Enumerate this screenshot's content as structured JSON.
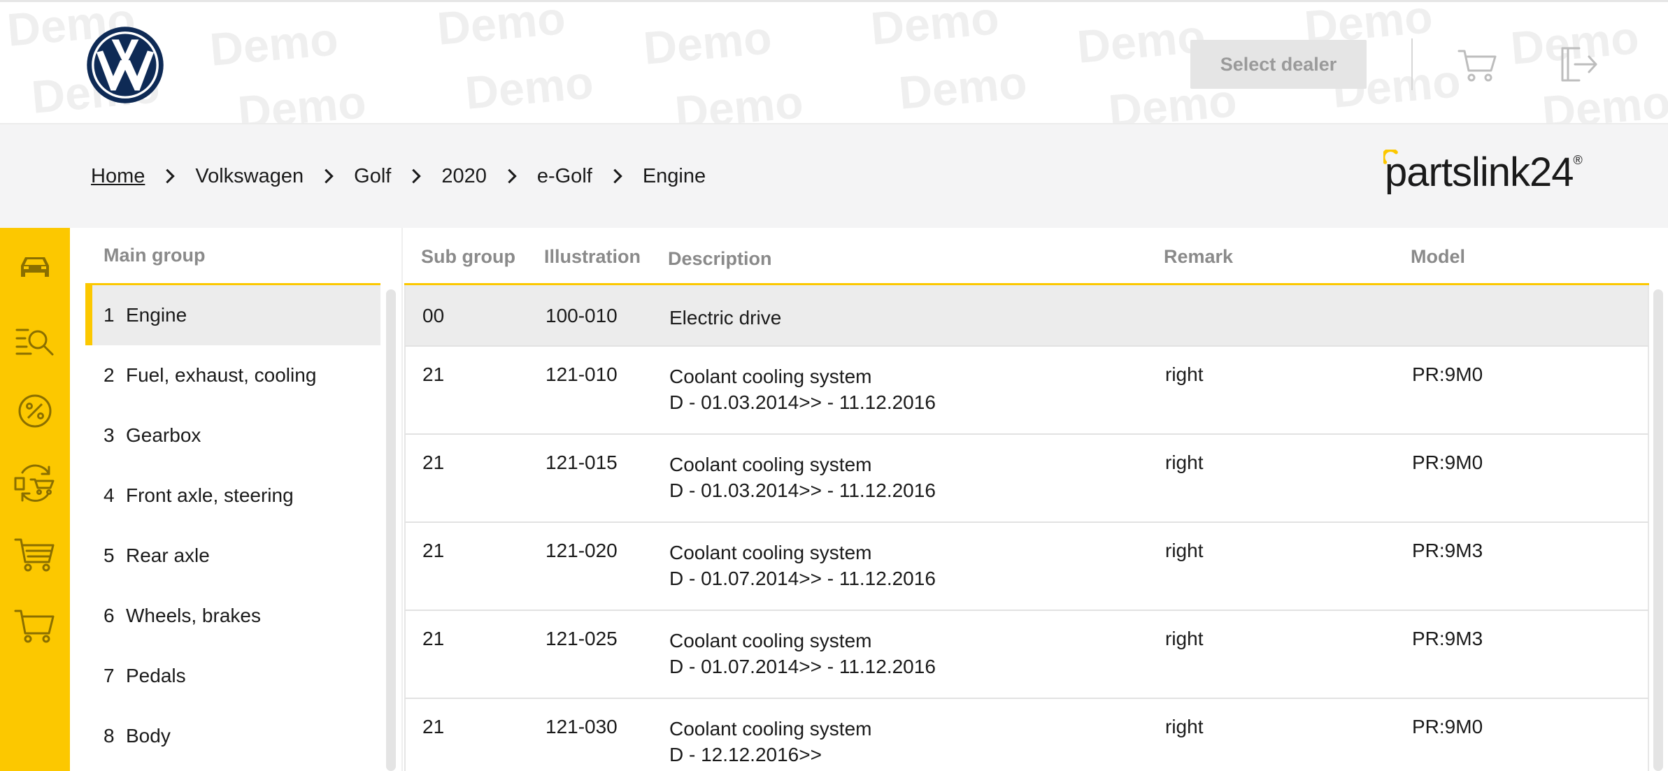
{
  "header": {
    "watermark_text": "Demo",
    "select_dealer_label": "Select dealer",
    "brand_icon": "vw-logo",
    "icons": [
      "cart-icon",
      "logout-icon"
    ]
  },
  "breadcrumb": {
    "items": [
      "Home",
      "Volkswagen",
      "Golf",
      "2020",
      "e-Golf",
      "Engine"
    ]
  },
  "partslink": {
    "text_a": "partslink",
    "text_b": "24",
    "reg": "®"
  },
  "rail": {
    "icons": [
      "car-icon",
      "search-list-icon",
      "percent-icon",
      "cart-exchange-icon",
      "cart-full-icon",
      "cart-icon"
    ]
  },
  "main_group": {
    "header": "Main group",
    "items": [
      {
        "num": "1",
        "label": "Engine"
      },
      {
        "num": "2",
        "label": "Fuel, exhaust, cooling"
      },
      {
        "num": "3",
        "label": "Gearbox"
      },
      {
        "num": "4",
        "label": "Front axle, steering"
      },
      {
        "num": "5",
        "label": "Rear axle"
      },
      {
        "num": "6",
        "label": "Wheels, brakes"
      },
      {
        "num": "7",
        "label": "Pedals"
      },
      {
        "num": "8",
        "label": "Body"
      }
    ]
  },
  "table": {
    "headers": {
      "sub": "Sub group",
      "ill": "Illustration",
      "desc": "Description",
      "rem": "Remark",
      "mod": "Model"
    },
    "rows": [
      {
        "sub": "00",
        "ill": "100-010",
        "desc1": "Electric drive",
        "desc2": "",
        "rem": "",
        "mod": ""
      },
      {
        "sub": "21",
        "ill": "121-010",
        "desc1": "Coolant cooling system",
        "desc2": "D - 01.03.2014>> - 11.12.2016",
        "rem": "right",
        "mod": "PR:9M0"
      },
      {
        "sub": "21",
        "ill": "121-015",
        "desc1": "Coolant cooling system",
        "desc2": "D - 01.03.2014>> - 11.12.2016",
        "rem": "right",
        "mod": "PR:9M0"
      },
      {
        "sub": "21",
        "ill": "121-020",
        "desc1": "Coolant cooling system",
        "desc2": "D - 01.07.2014>> - 11.12.2016",
        "rem": "right",
        "mod": "PR:9M3"
      },
      {
        "sub": "21",
        "ill": "121-025",
        "desc1": "Coolant cooling system",
        "desc2": "D - 01.07.2014>> - 11.12.2016",
        "rem": "right",
        "mod": "PR:9M3"
      },
      {
        "sub": "21",
        "ill": "121-030",
        "desc1": "Coolant cooling system",
        "desc2": "D - 12.12.2016>>",
        "rem": "right",
        "mod": "PR:9M0"
      }
    ]
  },
  "colors": {
    "accent": "#fcc800",
    "vw_blue": "#0e2a55",
    "muted": "#8a8a8a"
  }
}
